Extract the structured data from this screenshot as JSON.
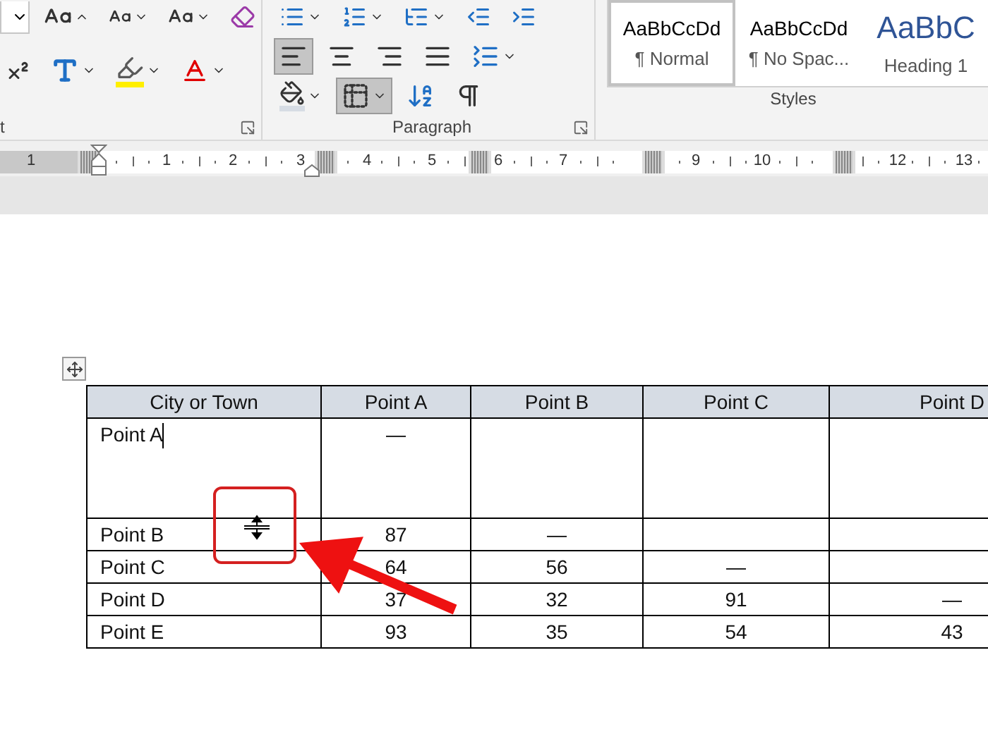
{
  "ribbon": {
    "font_group": {
      "label": "t"
    },
    "paragraph_group": {
      "label": "Paragraph",
      "alignments": [
        {
          "kind": "left",
          "selected": true
        },
        {
          "kind": "center",
          "selected": false
        },
        {
          "kind": "right",
          "selected": false
        },
        {
          "kind": "justify",
          "selected": false
        }
      ],
      "borders_selected": true
    },
    "styles_group": {
      "label": "Styles",
      "styles": [
        {
          "kind": "body",
          "sample": "AaBbCcDd",
          "name": "¶ Normal",
          "selected": true
        },
        {
          "kind": "body",
          "sample": "AaBbCcDd",
          "name": "¶ No Spac...",
          "selected": false
        },
        {
          "kind": "heading",
          "sample": "AaBbC",
          "name": "Heading 1",
          "selected": false
        }
      ]
    }
  },
  "ruler": {
    "numbers": [
      "1",
      "1",
      "2",
      "3",
      "4",
      "5",
      "6",
      "7",
      "9",
      "10",
      "12",
      "13"
    ]
  },
  "table": {
    "columns": [
      "City or Town",
      "Point A",
      "Point B",
      "Point C",
      "Point D"
    ],
    "rows": [
      {
        "label": "Point A",
        "caret": true,
        "values": [
          "—"
        ]
      },
      {
        "label": "Point B",
        "caret": false,
        "values": [
          "87",
          "—"
        ]
      },
      {
        "label": "Point C",
        "caret": false,
        "values": [
          "64",
          "56",
          "—"
        ]
      },
      {
        "label": "Point D",
        "caret": false,
        "values": [
          "37",
          "32",
          "91",
          "—"
        ]
      },
      {
        "label": "Point E",
        "caret": false,
        "values": [
          "93",
          "35",
          "54",
          "43"
        ]
      }
    ]
  }
}
